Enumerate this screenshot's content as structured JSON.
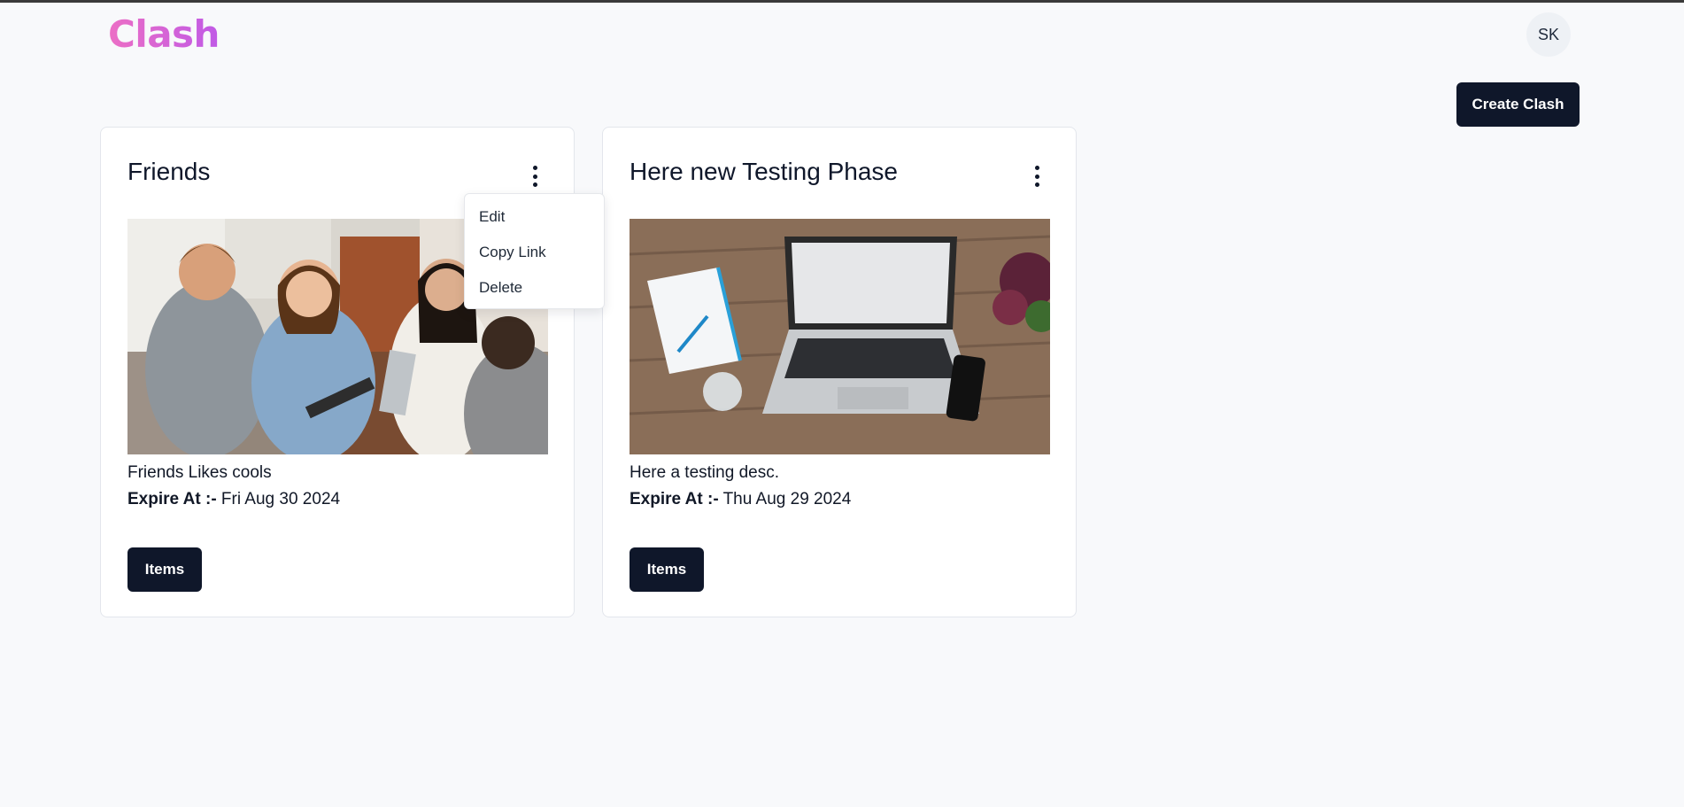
{
  "app": {
    "logo": "Clash"
  },
  "header": {
    "avatar_initials": "SK",
    "create_label": "Create Clash"
  },
  "cards": [
    {
      "title": "Friends",
      "description": "Friends Likes cools",
      "expire_label": "Expire At :-",
      "expire_value": "Fri Aug 30 2024",
      "items_label": "Items",
      "image": "photo-friends-cafe"
    },
    {
      "title": "Here new Testing Phase",
      "description": "Here a testing desc.",
      "expire_label": "Expire At :-",
      "expire_value": "Thu Aug 29 2024",
      "items_label": "Items",
      "image": "photo-laptop-desk"
    }
  ],
  "dropdown": {
    "items": [
      "Edit",
      "Copy Link",
      "Delete"
    ]
  },
  "colors": {
    "primary": "#0f172a",
    "background": "#f8f9fb",
    "logo_gradient_start": "#ec6fc5",
    "logo_gradient_end": "#c05ae6"
  },
  "icons": {
    "kebab": "more-vertical-icon"
  }
}
